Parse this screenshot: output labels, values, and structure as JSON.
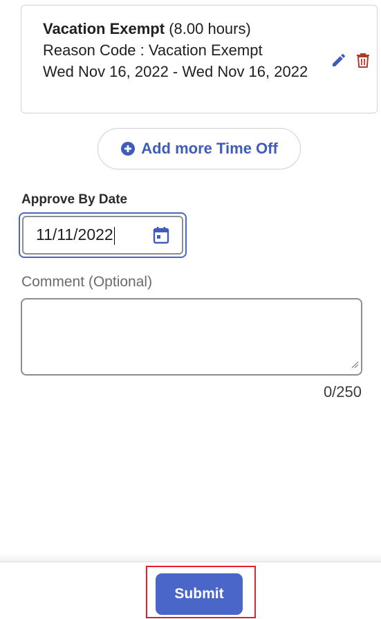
{
  "time_off_entry": {
    "type": "Vacation Exempt",
    "hours": "(8.00 hours)",
    "reason": "Reason Code : Vacation Exempt",
    "date_range": "Wed Nov 16, 2022 - Wed Nov 16, 2022",
    "edit_icon": "pencil-icon",
    "delete_icon": "trash-icon",
    "edit_color": "#3e5cb8",
    "delete_color": "#b23a2a"
  },
  "add_more": {
    "label": "Add more Time Off",
    "icon": "plus-circle-icon"
  },
  "approve_by": {
    "label": "Approve By Date",
    "value": "11/11/2022",
    "icon": "calendar-icon"
  },
  "comment": {
    "label": "Comment (Optional)",
    "value": "",
    "counter": "0/250"
  },
  "footer": {
    "submit_label": "Submit",
    "accent": "#4a66c8"
  }
}
